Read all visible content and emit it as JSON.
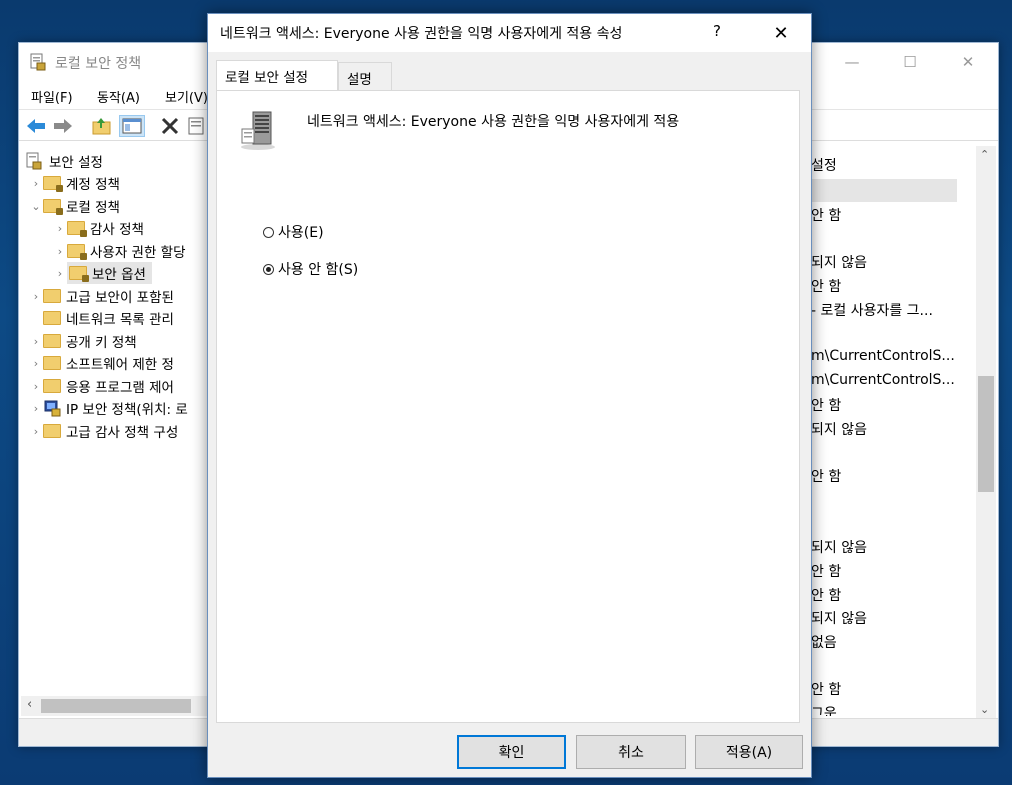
{
  "bg_window": {
    "title": "로컬 보안 정책",
    "menu": [
      "파일(F)",
      "동작(A)",
      "보기(V)"
    ],
    "tree": {
      "root": "보안 설정",
      "items": [
        {
          "label": "계정 정책",
          "level": 1,
          "expanded": false
        },
        {
          "label": "로컬 정책",
          "level": 1,
          "expanded": true
        },
        {
          "label": "감사 정책",
          "level": 2,
          "expanded": false
        },
        {
          "label": "사용자 권한 할당",
          "level": 2,
          "expanded": false
        },
        {
          "label": "보안 옵션",
          "level": 2,
          "expanded": false,
          "selected": true
        },
        {
          "label": "고급 보안이 포함된",
          "level": 1,
          "expanded": false
        },
        {
          "label": "네트워크 목록 관리",
          "level": 1,
          "expanded": false
        },
        {
          "label": "공개 키 정책",
          "level": 1,
          "expanded": false
        },
        {
          "label": "소프트웨어 제한 정",
          "level": 1,
          "expanded": false
        },
        {
          "label": "응용 프로그램 제어",
          "level": 1,
          "expanded": false
        },
        {
          "label": "IP 보안 정책(위치: 로",
          "level": 1,
          "expanded": false
        },
        {
          "label": "고급 감사 정책 구성",
          "level": 1,
          "expanded": false
        }
      ]
    },
    "right_column_header": "설정",
    "right_column_values": [
      "안 함",
      "되지 않음",
      "안 함",
      "- 로컬 사용자를 그...",
      "m\\CurrentControlS...",
      "m\\CurrentControlS...",
      "안 함",
      "되지 않음",
      "안 함",
      "되지 않음",
      "안 함",
      "안 함",
      "되지 않음",
      "없음",
      "안 함",
      "그운"
    ]
  },
  "dialog": {
    "title": "네트워크 액세스: Everyone 사용 권한을 익명 사용자에게 적용 속성",
    "help": "?",
    "tabs": [
      "로컬 보안 설정",
      "설명"
    ],
    "policy_name": "네트워크 액세스: Everyone 사용 권한을 익명 사용자에게 적용",
    "options": [
      {
        "label": "사용(E)",
        "selected": false
      },
      {
        "label": "사용 안 함(S)",
        "selected": true
      }
    ],
    "buttons": {
      "ok": "확인",
      "cancel": "취소",
      "apply": "적용(A)"
    }
  }
}
